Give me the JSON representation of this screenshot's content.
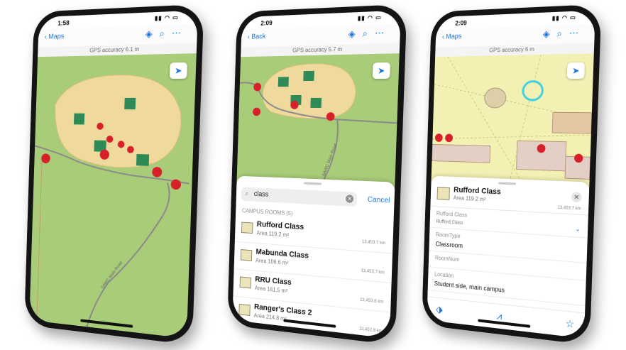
{
  "phone1": {
    "time": "1:58",
    "nav": {
      "back_label": "Maps"
    },
    "gps_accuracy": "GPS accuracy 6.1 m",
    "road_label": "SAWC Main Road"
  },
  "phone2": {
    "time": "2:09",
    "nav": {
      "back_label": "Back"
    },
    "gps_accuracy": "GPS accuracy 5.7 m",
    "road_label": "SAWC Main Road",
    "search": {
      "query": "class",
      "cancel_label": "Cancel"
    },
    "section_label": "CAMPUS ROOMS (5)",
    "results": [
      {
        "name": "Rufford Class",
        "area": "Area 119.2 m²",
        "distance": "13,453.7 km"
      },
      {
        "name": "Mabunda Class",
        "area": "Area 106.6 m²",
        "distance": "13,453.7 km"
      },
      {
        "name": "RRU Class",
        "area": "Area 161.5 m²",
        "distance": "13,453.8 km"
      },
      {
        "name": "Ranger's Class 2",
        "area": "Area 214.8 m²",
        "distance": "13,452.8 km"
      }
    ]
  },
  "phone3": {
    "time": "2:09",
    "nav": {
      "back_label": "Maps"
    },
    "gps_accuracy": "GPS accuracy 6 m",
    "feature": {
      "name": "Rufford Class",
      "area": "Area 119.2 m²",
      "distance": "13,453.7 km"
    },
    "fields": [
      {
        "label": "Rufford Class",
        "value": "Rufford Class",
        "small": true
      },
      {
        "label": "RoomType",
        "value": "Classroom",
        "small": false
      },
      {
        "label": "RoomNum",
        "value": "",
        "small": false
      },
      {
        "label": "Location",
        "value": "Student side, main campus",
        "small": false
      }
    ]
  },
  "colors": {
    "accent": "#1a73d9",
    "map_green": "#a9cc79",
    "campus_sand": "#efd99c",
    "building_fill": "#ece3b8",
    "poi_red": "#d8202a",
    "poi_green": "#2e8a57"
  }
}
